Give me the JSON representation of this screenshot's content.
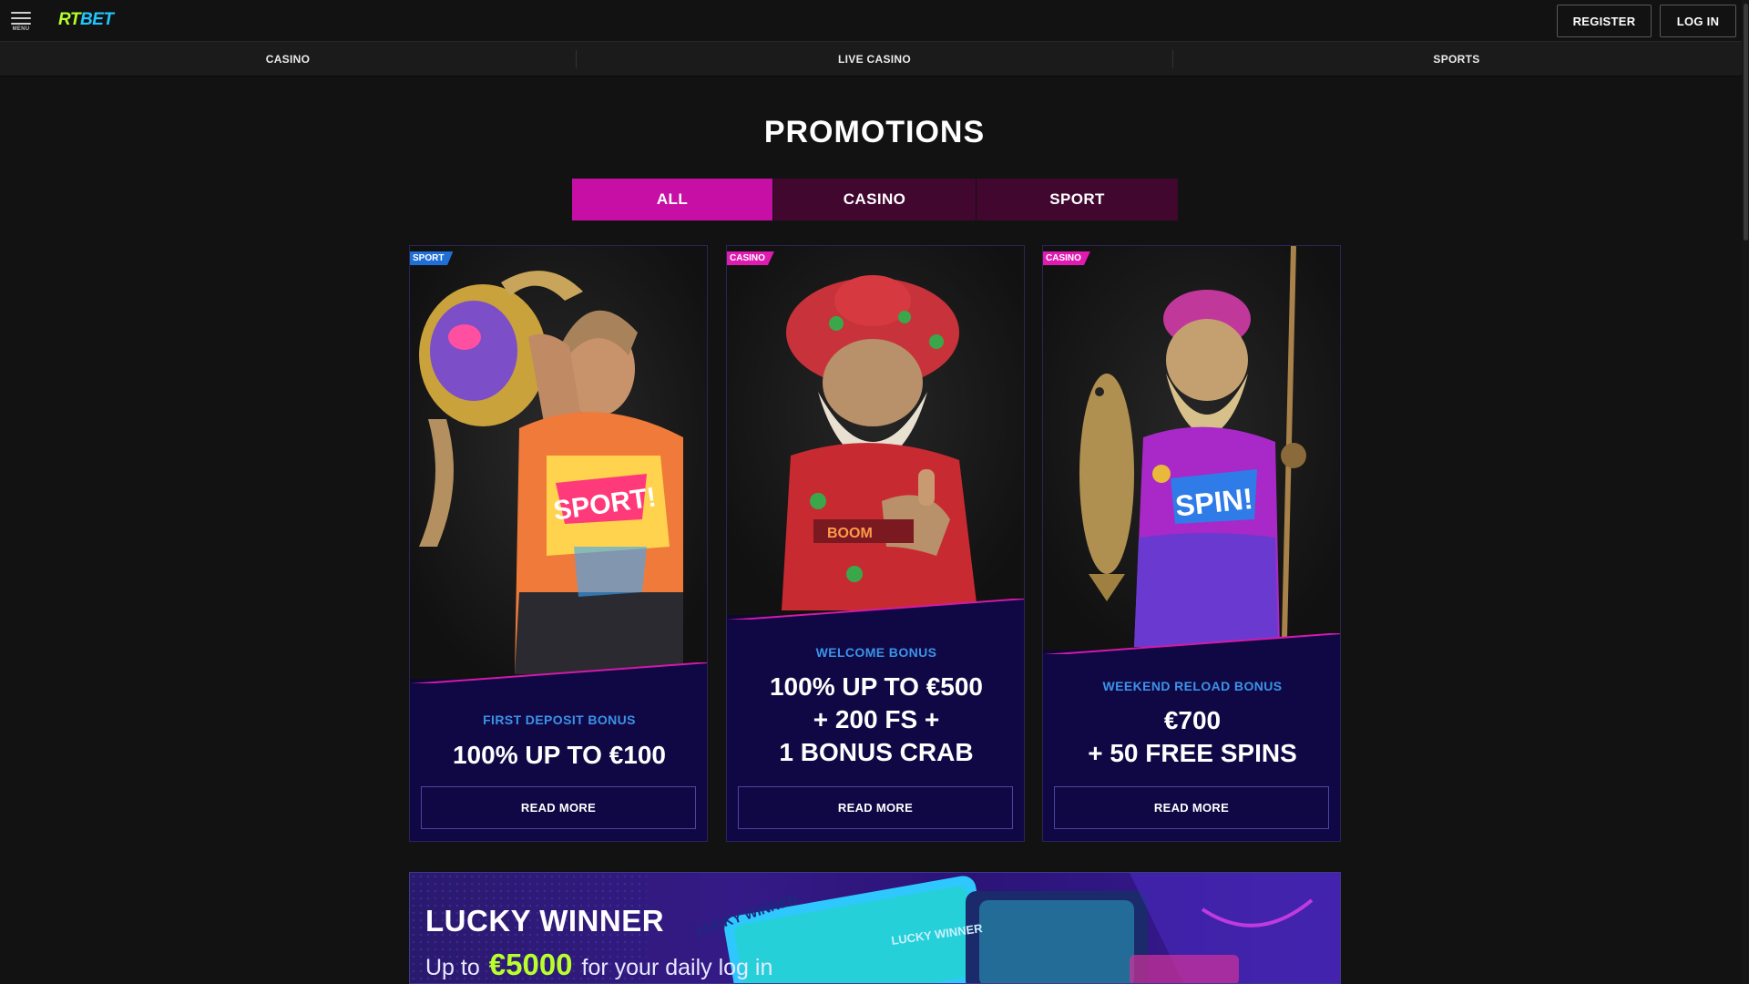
{
  "header": {
    "menu_label": "MENU",
    "logo_rt": "RT",
    "logo_bet": "BET",
    "register_label": "REGISTER",
    "login_label": "LOG IN"
  },
  "category_nav": [
    {
      "label": "CASINO"
    },
    {
      "label": "LIVE CASINO"
    },
    {
      "label": "SPORTS"
    }
  ],
  "page": {
    "title": "PROMOTIONS"
  },
  "filters": [
    {
      "label": "ALL",
      "active": true
    },
    {
      "label": "CASINO",
      "active": false
    },
    {
      "label": "SPORT",
      "active": false
    }
  ],
  "promos": [
    {
      "badge": "SPORT",
      "bonus_label": "FIRST DEPOSIT BONUS",
      "title_lines": [
        "100% UP TO €100"
      ],
      "button": "READ MORE"
    },
    {
      "badge": "CASINO",
      "bonus_label": "WELCOME BONUS",
      "title_lines": [
        "100% UP TO €500",
        "+ 200 FS +",
        "1 BONUS CRAB"
      ],
      "button": "READ MORE"
    },
    {
      "badge": "CASINO",
      "bonus_label": "WEEKEND RELOAD BONUS",
      "title_lines": [
        "€700",
        "+ 50 FREE SPINS"
      ],
      "button": "READ MORE"
    }
  ],
  "banner": {
    "title": "LUCKY WINNER",
    "sub_prefix": "Up to",
    "amount": "€5000",
    "sub_suffix": "for your daily log in",
    "ticket_text": "LUCKY WINNER"
  },
  "colors": {
    "accent_pink": "#c70fa6",
    "filter_inactive": "#41072f",
    "card_panel": "#0f0845",
    "label_blue": "#3b93e8",
    "logo_green": "#b4ff2b",
    "logo_blue": "#1ec7ff",
    "amount_green": "#b8ff2c"
  }
}
